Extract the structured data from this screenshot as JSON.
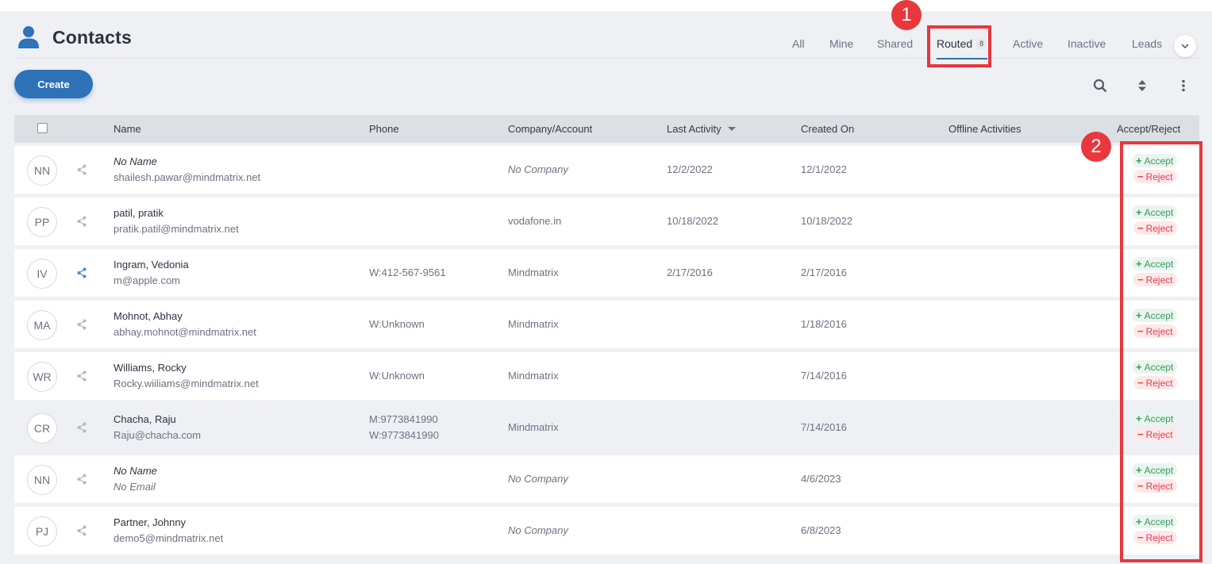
{
  "page": {
    "title": "Contacts"
  },
  "tabs": [
    {
      "label": "All"
    },
    {
      "label": "Mine"
    },
    {
      "label": "Shared"
    },
    {
      "label": "Routed",
      "badge": "8",
      "active": true
    },
    {
      "label": "Active"
    },
    {
      "label": "Inactive"
    },
    {
      "label": "Leads"
    }
  ],
  "toolbar": {
    "create_label": "Create"
  },
  "table": {
    "headers": {
      "name": "Name",
      "phone": "Phone",
      "company": "Company/Account",
      "last_activity": "Last Activity",
      "created_on": "Created On",
      "offline": "Offline Activities",
      "accept_reject": "Accept/Reject"
    },
    "rows": [
      {
        "initials": "NN",
        "name": "No Name",
        "email": "shailesh.pawar@mindmatrix.net",
        "phone1": "",
        "phone2": "",
        "company": "No Company",
        "last_activity": "12/2/2022",
        "created_on": "12/1/2022"
      },
      {
        "initials": "PP",
        "name": "patil, pratik",
        "email": "pratik.patil@mindmatrix.net",
        "phone1": "",
        "phone2": "",
        "company": "vodafone.in",
        "last_activity": "10/18/2022",
        "created_on": "10/18/2022"
      },
      {
        "initials": "IV",
        "name": "Ingram, Vedonia",
        "email": "m@apple.com",
        "phone1": "W:412-567-9561",
        "phone2": "",
        "company": "Mindmatrix",
        "last_activity": "2/17/2016",
        "created_on": "2/17/2016"
      },
      {
        "initials": "MA",
        "name": "Mohnot, Abhay",
        "email": "abhay.mohnot@mindmatrix.net",
        "phone1": "W:Unknown",
        "phone2": "",
        "company": "Mindmatrix",
        "last_activity": "",
        "created_on": "1/18/2016"
      },
      {
        "initials": "WR",
        "name": "Williams, Rocky",
        "email": "Rocky.wiiliams@mindmatrix.net",
        "phone1": "W:Unknown",
        "phone2": "",
        "company": "Mindmatrix",
        "last_activity": "",
        "created_on": "7/14/2016"
      },
      {
        "initials": "CR",
        "name": "Chacha, Raju",
        "email": "Raju@chacha.com",
        "phone1": "M:9773841990",
        "phone2": "W:9773841990",
        "company": "Mindmatrix",
        "last_activity": "",
        "created_on": "7/14/2016"
      },
      {
        "initials": "NN",
        "name": "No Name",
        "email": "No Email",
        "phone1": "",
        "phone2": "",
        "company": "No Company",
        "last_activity": "",
        "created_on": "4/6/2023"
      },
      {
        "initials": "PJ",
        "name": "Partner, Johnny",
        "email": "demo5@mindmatrix.net",
        "phone1": "",
        "phone2": "",
        "company": "No Company",
        "last_activity": "",
        "created_on": "6/8/2023"
      }
    ],
    "accept_label": "Accept",
    "reject_label": "Reject"
  },
  "annotations": [
    {
      "number": "1"
    },
    {
      "number": "2"
    }
  ],
  "colors": {
    "primary": "#2e72b8",
    "accept": "#3a9a5e",
    "reject": "#e0414c",
    "callout": "#e8373d",
    "shared_active": "#3d8fd9"
  }
}
